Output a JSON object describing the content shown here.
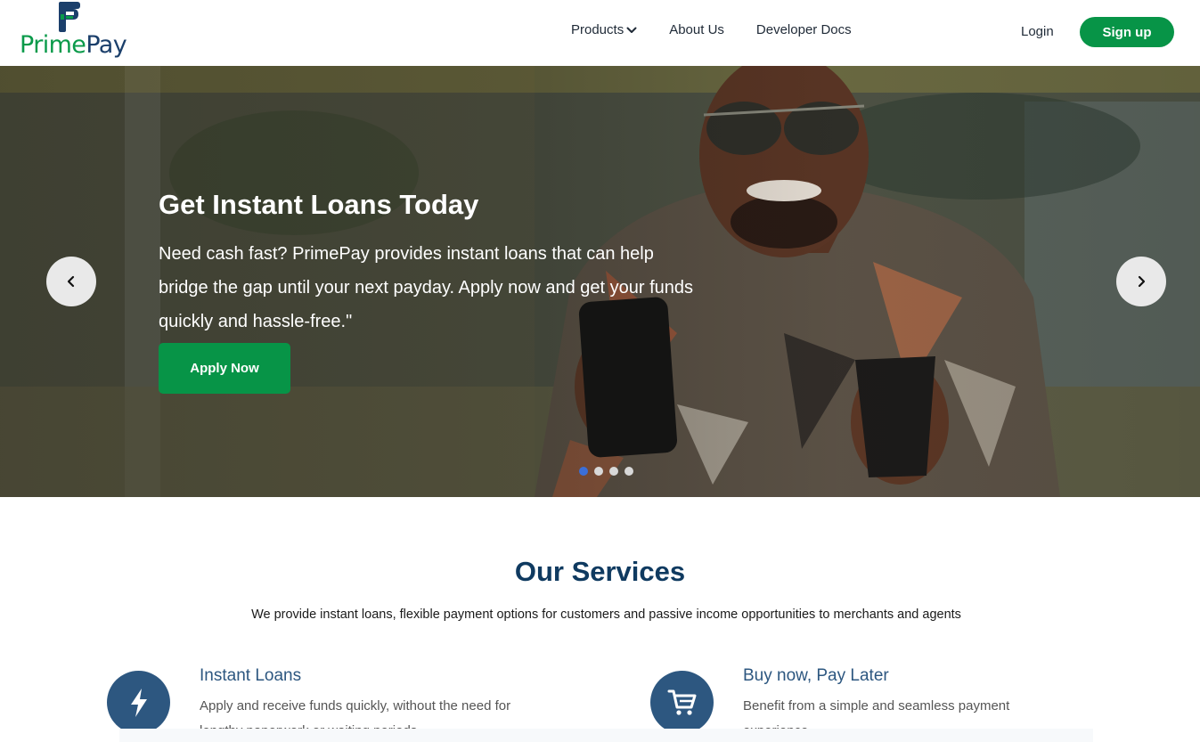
{
  "brand": {
    "name_part1": "Prime",
    "name_part2": "Pay",
    "green": "#079447",
    "navy": "#1b3f6b"
  },
  "nav": {
    "products": "Products",
    "about": "About Us",
    "docs": "Developer Docs",
    "login": "Login",
    "signup": "Sign up"
  },
  "hero": {
    "title": "Get Instant Loans Today",
    "text": "Need cash fast? PrimePay provides instant loans that can help bridge the gap until your next payday. Apply now and get your funds quickly and hassle-free.\"",
    "cta": "Apply Now",
    "active_slide": 1,
    "slide_count": 4
  },
  "services": {
    "title": "Our Services",
    "subtitle": "We provide instant loans, flexible payment options for customers and passive income opportunities to merchants and agents",
    "items": [
      {
        "title": "Instant Loans",
        "description": "Apply and receive funds quickly, without the need for lengthy paperwork or waiting periods.",
        "icon": "lightning-icon"
      },
      {
        "title": "Buy now, Pay Later",
        "description": "Benefit from a simple and seamless payment experience.",
        "icon": "cart-icon"
      }
    ]
  }
}
